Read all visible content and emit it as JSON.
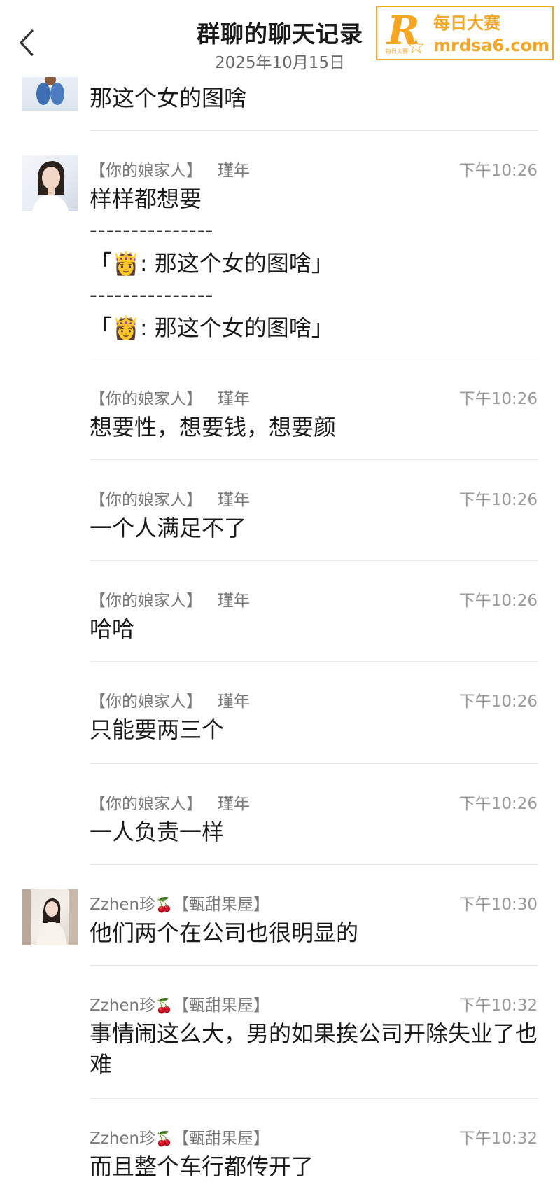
{
  "header": {
    "title": "群聊的聊天记录",
    "date": "2025年10月15日"
  },
  "watermark": {
    "brand_letter": "R",
    "brand_cn": "每日大赛",
    "brand_small": "每日大赛",
    "url": "mrdsa6.com",
    "color": "#f5a623"
  },
  "messages": [
    {
      "text": "那这个女的图啥"
    },
    {
      "sender_group": "【你的娘家人】",
      "sender_name": "瑾年",
      "time": "下午10:26",
      "text": "样样都想要",
      "divider": "---------------",
      "quote1": "「👸: 那这个女的图啥」",
      "quote2": "「👸: 那这个女的图啥」"
    },
    {
      "sender_group": "【你的娘家人】",
      "sender_name": "瑾年",
      "time": "下午10:26",
      "text": "想要性，想要钱，想要颜"
    },
    {
      "sender_group": "【你的娘家人】",
      "sender_name": "瑾年",
      "time": "下午10:26",
      "text": "一个人满足不了"
    },
    {
      "sender_group": "【你的娘家人】",
      "sender_name": "瑾年",
      "time": "下午10:26",
      "text": "哈哈"
    },
    {
      "sender_group": "【你的娘家人】",
      "sender_name": "瑾年",
      "time": "下午10:26",
      "text": "只能要两三个"
    },
    {
      "sender_group": "【你的娘家人】",
      "sender_name": "瑾年",
      "time": "下午10:26",
      "text": "一人负责一样"
    },
    {
      "sender_name": "Zzhen珍",
      "sender_emoji": "🍒",
      "sender_group": "【甄甜果屋】",
      "time": "下午10:30",
      "text": "他们两个在公司也很明显的"
    },
    {
      "sender_name": "Zzhen珍",
      "sender_emoji": "🍒",
      "sender_group": "【甄甜果屋】",
      "time": "下午10:32",
      "text": "事情闹这么大，男的如果挨公司开除失业了也难"
    },
    {
      "sender_name": "Zzhen珍",
      "sender_emoji": "🍒",
      "sender_group": "【甄甜果屋】",
      "time": "下午10:32",
      "text": "而且整个车行都传开了"
    }
  ]
}
